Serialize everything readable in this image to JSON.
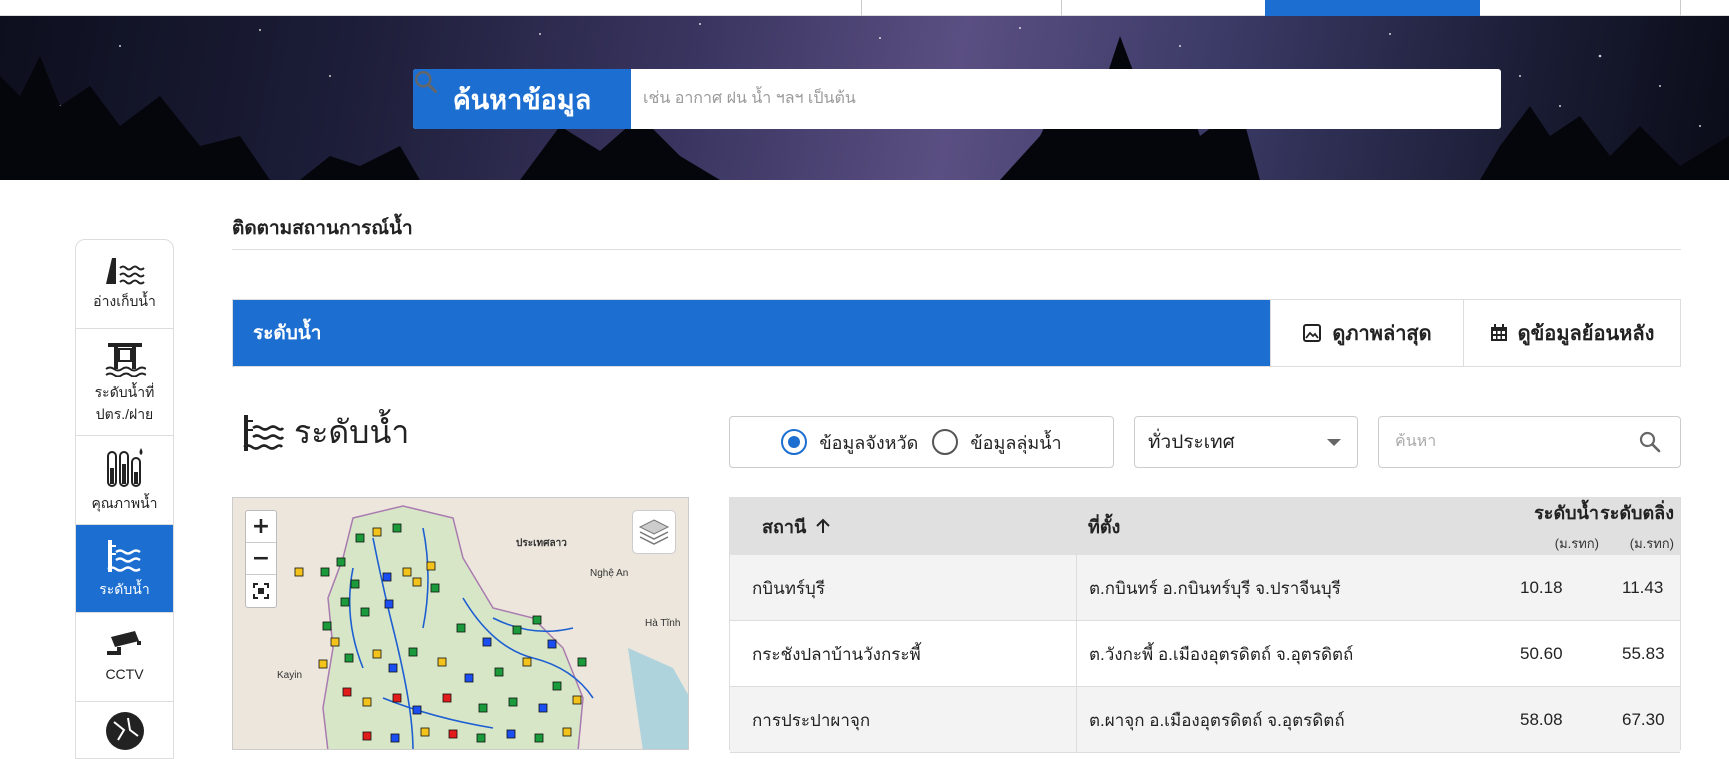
{
  "hero": {
    "search_label": "ค้นหาข้อมูล",
    "search_placeholder": "เช่น อากาศ ฝน น้ำ ฯลฯ เป็นต้น"
  },
  "sidebar": {
    "items": [
      {
        "label": "อ่างเก็บน้ำ",
        "icon": "reservoir-icon"
      },
      {
        "label": "ระดับน้ำที่\nปตร./ฝาย",
        "icon": "floodgate-icon"
      },
      {
        "label": "คุณภาพน้ำ",
        "icon": "water-quality-icon"
      },
      {
        "label": "ระดับน้ำ",
        "icon": "water-level-icon",
        "active": true
      },
      {
        "label": "CCTV",
        "icon": "cctv-icon"
      }
    ]
  },
  "page": {
    "title": "ติดตามสถานการณ์น้ำ",
    "section_label": "ระดับน้ำ",
    "latest_image_label": "ดูภาพล่าสุด",
    "history_label": "ดูข้อมูลย้อนหลัง",
    "sub_title": "ระดับน้ำ"
  },
  "filters": {
    "radio_province": "ข้อมูลจังหวัด",
    "radio_basin": "ข้อมูลลุ่มน้ำ",
    "selected_radio": "province",
    "region_select": "ทั่วประเทศ",
    "search_placeholder": "ค้นหา"
  },
  "map": {
    "zoom_in": "+",
    "zoom_out": "−",
    "labels": {
      "laos": "ประเทศลาว",
      "nghe_an": "Nghệ An",
      "ha_tinh": "Hà Tĩnh",
      "kayin": "Kayin"
    }
  },
  "table": {
    "headers": {
      "station": "สถานี",
      "location": "ที่ตั้ง",
      "water_level": "ระดับน้ำ",
      "water_level_unit": "(ม.รทก)",
      "bank_level": "ระดับตลิ่ง",
      "bank_level_unit": "(ม.รทก)"
    },
    "rows": [
      {
        "station": "กบินทร์บุรี",
        "location": "ต.กบินทร์ อ.กบินทร์บุรี จ.ปราจีนบุรี",
        "water_level": "10.18",
        "bank_level": "11.43"
      },
      {
        "station": "กระชังปลาบ้านวังกระพี้",
        "location": "ต.วังกะพี้ อ.เมืองอุตรดิตถ์ จ.อุตรดิตถ์",
        "water_level": "50.60",
        "bank_level": "55.83"
      },
      {
        "station": "การประปาผาจุก",
        "location": "ต.ผาจุก อ.เมืองอุตรดิตถ์ จ.อุตรดิตถ์",
        "water_level": "58.08",
        "bank_level": "67.30"
      }
    ]
  },
  "colors": {
    "primary": "#1c6fd1",
    "station_green": "#1a9a3a",
    "station_yellow": "#f3c21b",
    "station_red": "#e21b1b",
    "station_blue": "#1a4ef0"
  }
}
